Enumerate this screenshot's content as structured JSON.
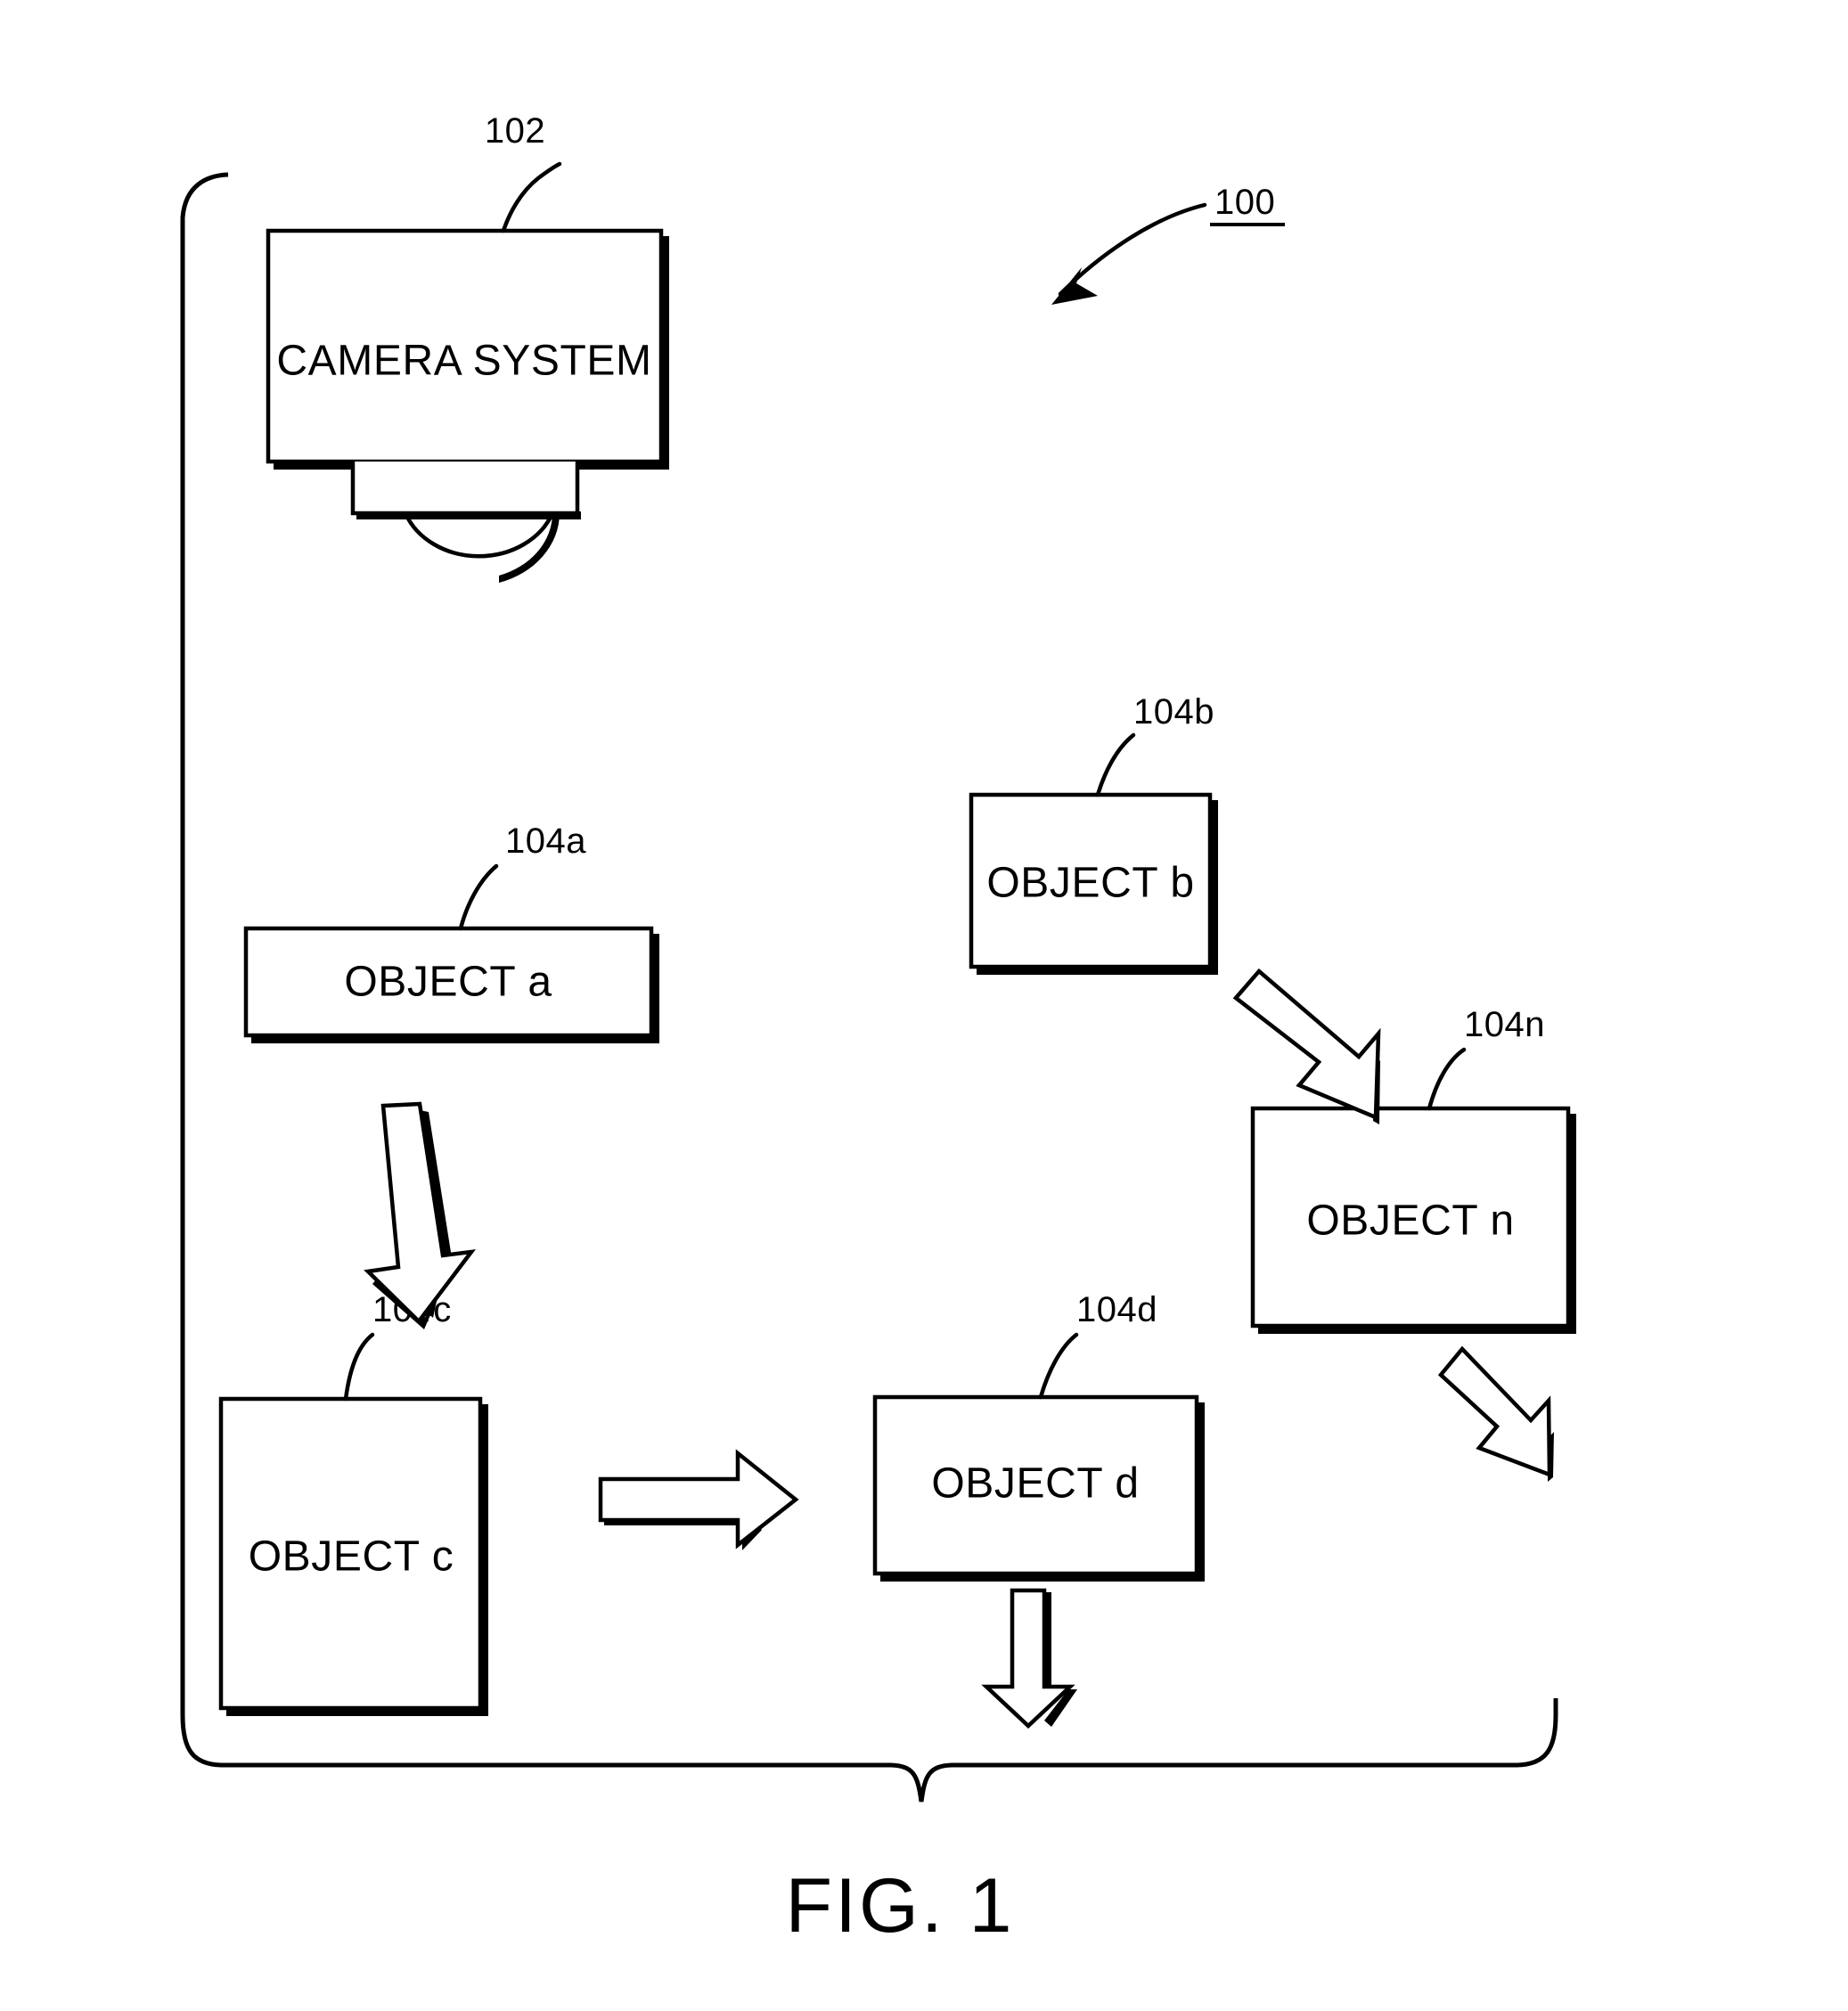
{
  "figure": {
    "caption": "FIG. 1",
    "system_ref": "100"
  },
  "camera": {
    "ref": "102",
    "label": "CAMERA SYSTEM"
  },
  "objects": [
    {
      "id": "a",
      "ref": "104a",
      "label": "OBJECT a"
    },
    {
      "id": "b",
      "ref": "104b",
      "label": "OBJECT b"
    },
    {
      "id": "c",
      "ref": "104c",
      "label": "OBJECT c"
    },
    {
      "id": "d",
      "ref": "104d",
      "label": "OBJECT d"
    },
    {
      "id": "n",
      "ref": "104n",
      "label": "OBJECT n"
    }
  ],
  "arrows": [
    {
      "name": "arrow-a-to-c",
      "direction": "down"
    },
    {
      "name": "arrow-b-to-n",
      "direction": "down-right"
    },
    {
      "name": "arrow-c-to-d",
      "direction": "right"
    },
    {
      "name": "arrow-d-down",
      "direction": "down"
    },
    {
      "name": "arrow-n-down",
      "direction": "down-right"
    }
  ],
  "colors": {
    "ink": "#000000",
    "paper": "#ffffff"
  },
  "chart_data": {
    "type": "diagram",
    "title": "FIG. 1",
    "nodes": [
      {
        "ref": "102",
        "label": "CAMERA SYSTEM",
        "shape": "camera-with-lens"
      },
      {
        "ref": "104a",
        "label": "OBJECT a",
        "shape": "rect"
      },
      {
        "ref": "104b",
        "label": "OBJECT b",
        "shape": "rect"
      },
      {
        "ref": "104c",
        "label": "OBJECT c",
        "shape": "rect"
      },
      {
        "ref": "104d",
        "label": "OBJECT d",
        "shape": "rect"
      },
      {
        "ref": "104n",
        "label": "OBJECT n",
        "shape": "rect"
      }
    ],
    "edges": [
      {
        "from": "104a",
        "to": "104c",
        "style": "block-arrow"
      },
      {
        "from": "104b",
        "to": "104n",
        "style": "block-arrow"
      },
      {
        "from": "104c",
        "to": "104d",
        "style": "block-arrow"
      },
      {
        "from": "104d",
        "to": "",
        "style": "block-arrow"
      },
      {
        "from": "104n",
        "to": "",
        "style": "block-arrow"
      }
    ],
    "enclosure": {
      "ref": "100",
      "style": "large-brace"
    }
  }
}
